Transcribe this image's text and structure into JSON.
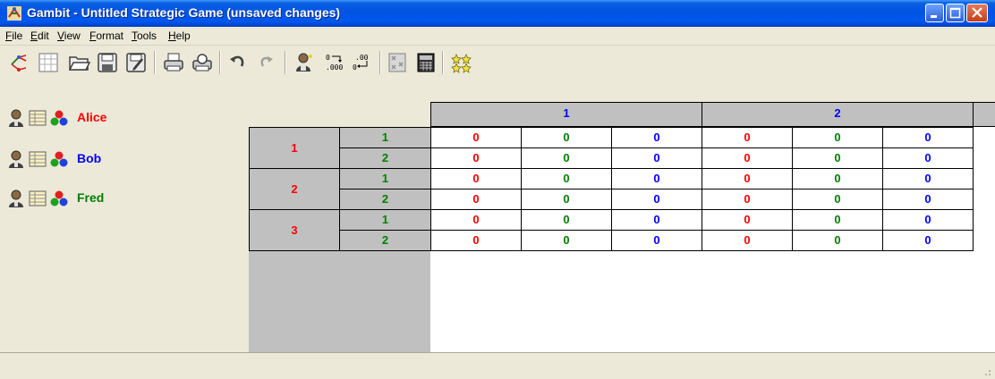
{
  "window": {
    "title": "Gambit - Untitled Strategic Game (unsaved changes)",
    "buttons": [
      "minimize",
      "maximize",
      "close"
    ]
  },
  "menu": {
    "items": [
      {
        "label": "File",
        "mnemonic": "F",
        "rest": "ile"
      },
      {
        "label": "Edit",
        "mnemonic": "E",
        "rest": "dit"
      },
      {
        "label": "View",
        "mnemonic": "V",
        "rest": "iew"
      },
      {
        "label": "Format",
        "mnemonic": "F",
        "rest": "ormat"
      },
      {
        "label": "Tools",
        "mnemonic": "T",
        "rest": "ools"
      },
      {
        "label": "Help",
        "mnemonic": "H",
        "rest": "elp"
      }
    ]
  },
  "toolbar": {
    "icons": [
      "new-tree-icon",
      "new-table-icon",
      "open-icon",
      "save-icon",
      "save-as-icon",
      "print-icon",
      "print-preview-icon",
      "undo-icon",
      "redo-icon",
      "add-player-icon",
      "decimal-format-icon",
      "rational-format-icon",
      "dominance-icon",
      "calculator-icon",
      "equilibria-icon"
    ],
    "decimal_label": ".000",
    "rational_label": ".00"
  },
  "players": [
    {
      "name": "Alice",
      "color": "#ff0000"
    },
    {
      "name": "Bob",
      "color": "#0000ff"
    },
    {
      "name": "Fred",
      "color": "#008000"
    }
  ],
  "table": {
    "col_headers": [
      "1",
      "2"
    ],
    "rows": [
      {
        "s1": "1",
        "s2": "1",
        "payoffs": [
          "0",
          "0",
          "0",
          "0",
          "0",
          "0"
        ]
      },
      {
        "s1": "",
        "s2": "2",
        "payoffs": [
          "0",
          "0",
          "0",
          "0",
          "0",
          "0"
        ]
      },
      {
        "s1": "2",
        "s2": "1",
        "payoffs": [
          "0",
          "0",
          "0",
          "0",
          "0",
          "0"
        ]
      },
      {
        "s1": "",
        "s2": "2",
        "payoffs": [
          "0",
          "0",
          "0",
          "0",
          "0",
          "0"
        ]
      },
      {
        "s1": "3",
        "s2": "1",
        "payoffs": [
          "0",
          "0",
          "0",
          "0",
          "0",
          "0"
        ]
      },
      {
        "s1": "",
        "s2": "2",
        "payoffs": [
          "0",
          "0",
          "0",
          "0",
          "0",
          "0"
        ]
      }
    ]
  }
}
